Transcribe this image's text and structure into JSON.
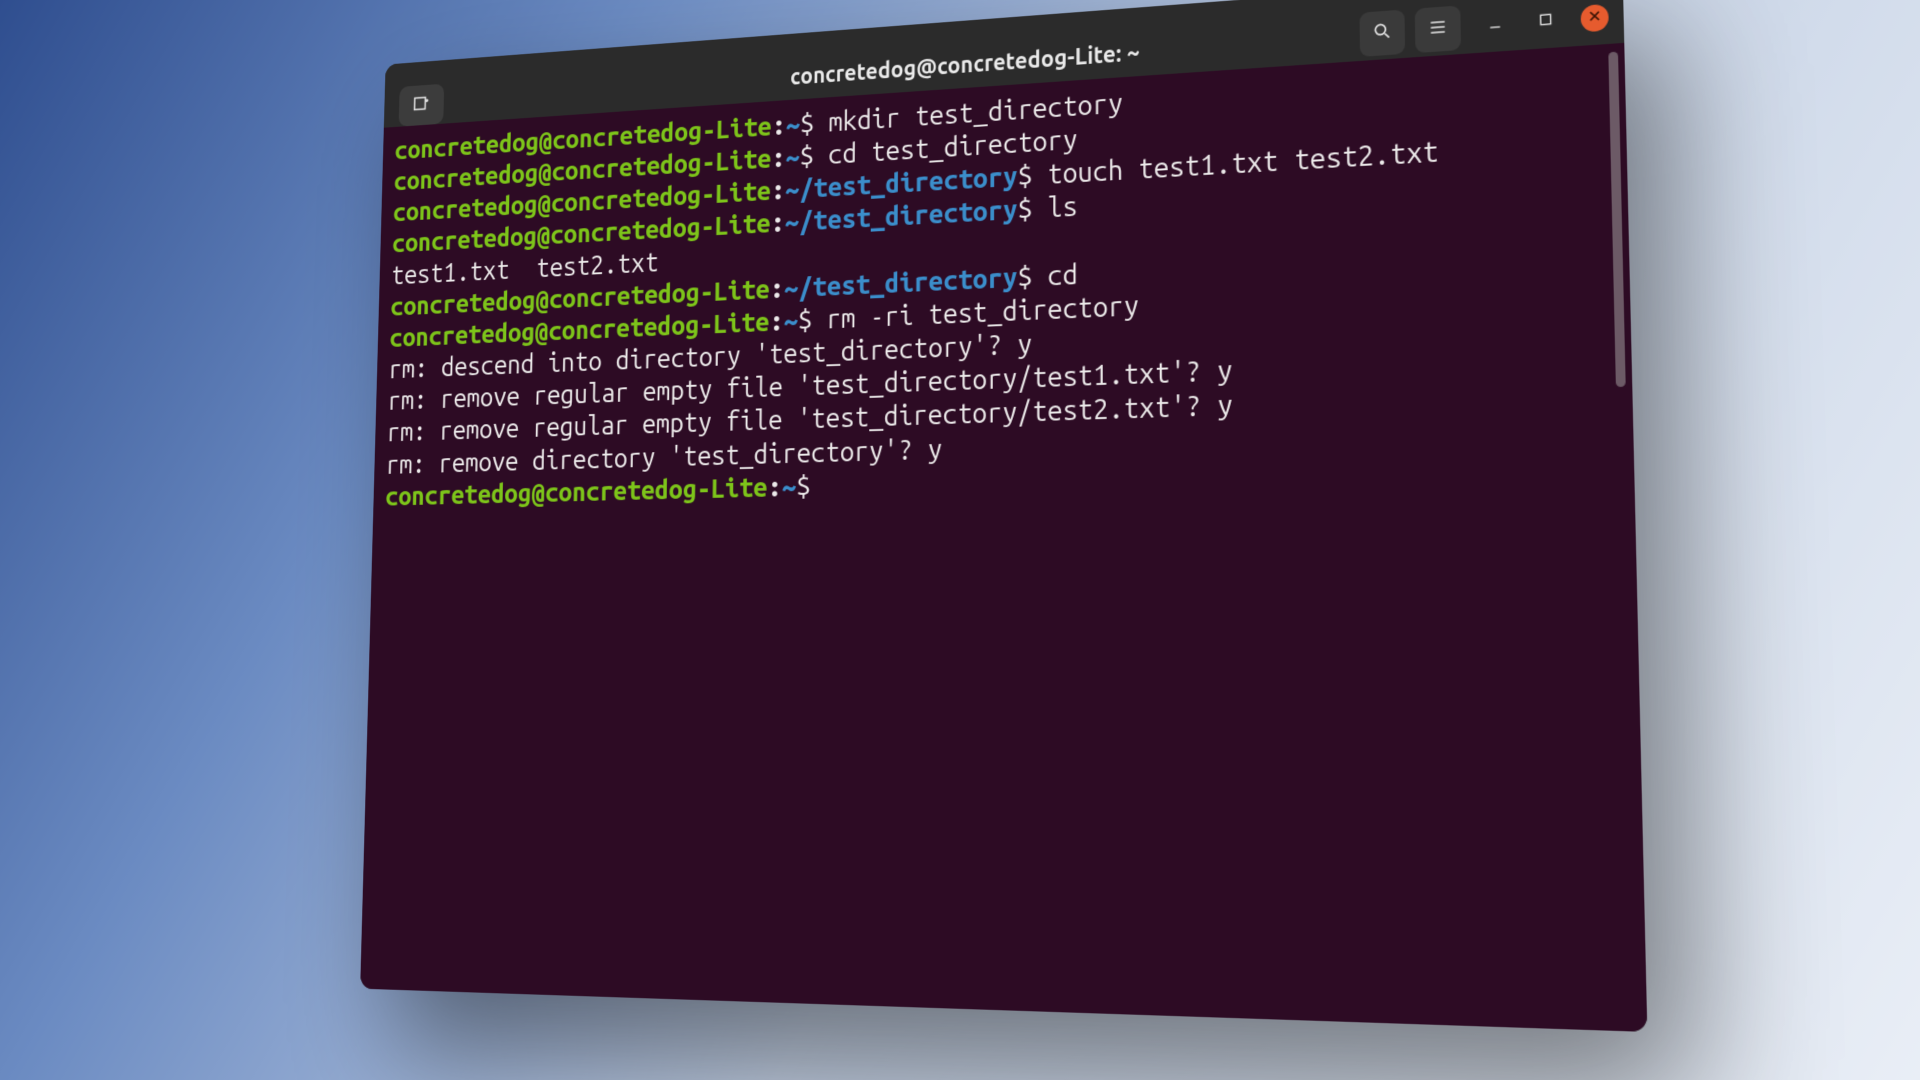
{
  "window": {
    "title": "concretedog@concretedog-Lite: ~"
  },
  "prompt": {
    "user_host": "concretedog@concretedog-Lite",
    "home": "~",
    "path_testdir": "~/test_directory",
    "sep": ":",
    "sigil": "$"
  },
  "lines": [
    {
      "type": "prompt",
      "path": "home",
      "cmd": "mkdir test_directory"
    },
    {
      "type": "prompt",
      "path": "home",
      "cmd": "cd test_directory"
    },
    {
      "type": "prompt",
      "path": "path_testdir",
      "cmd": "touch test1.txt test2.txt"
    },
    {
      "type": "prompt",
      "path": "path_testdir",
      "cmd": "ls"
    },
    {
      "type": "output",
      "text": "test1.txt  test2.txt"
    },
    {
      "type": "prompt",
      "path": "path_testdir",
      "cmd": "cd"
    },
    {
      "type": "prompt",
      "path": "home",
      "cmd": "rm -ri test_directory"
    },
    {
      "type": "output",
      "text": "rm: descend into directory 'test_directory'? y"
    },
    {
      "type": "output",
      "text": "rm: remove regular empty file 'test_directory/test1.txt'? y"
    },
    {
      "type": "output",
      "text": "rm: remove regular empty file 'test_directory/test2.txt'? y"
    },
    {
      "type": "output",
      "text": "rm: remove directory 'test_directory'? y"
    },
    {
      "type": "prompt",
      "path": "home",
      "cmd": ""
    }
  ],
  "icons": {
    "new_tab": "new-tab-icon",
    "search": "search-icon",
    "menu": "hamburger-menu-icon",
    "minimize": "minimize-icon",
    "maximize": "maximize-icon",
    "close": "close-icon"
  }
}
